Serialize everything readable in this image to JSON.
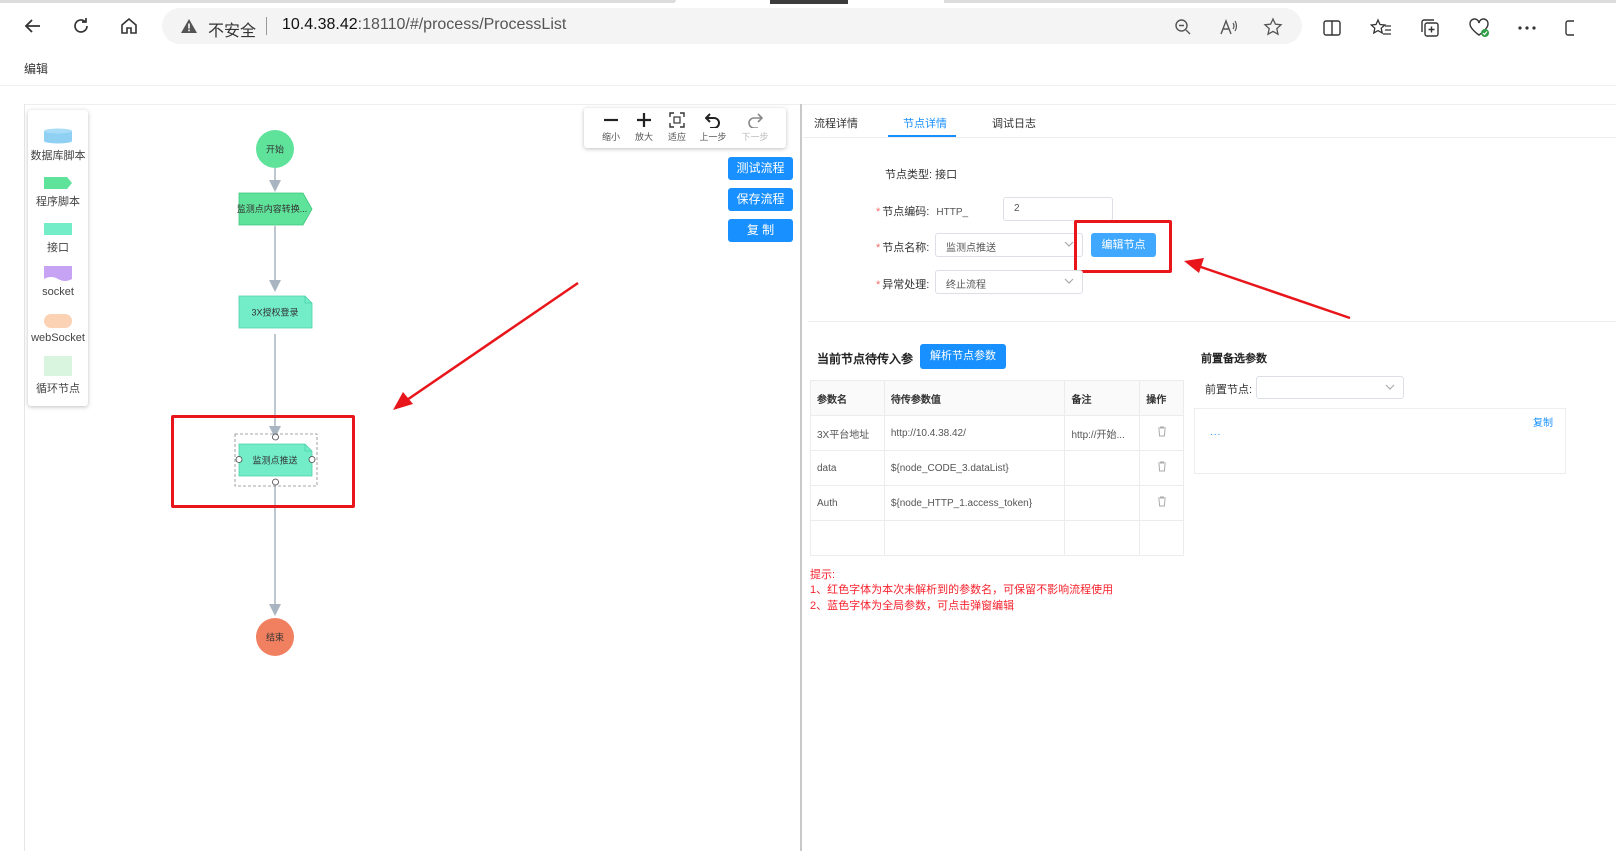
{
  "browser": {
    "insecure_label": "不安全",
    "url_host": "10.4.38.42",
    "url_rest": ":18110/#/process/ProcessList"
  },
  "page": {
    "title": "编辑"
  },
  "palette": {
    "items": [
      {
        "label": "数据库脚本",
        "icon": "database-icon"
      },
      {
        "label": "程序脚本",
        "icon": "script-icon"
      },
      {
        "label": "接口",
        "icon": "interface-icon"
      },
      {
        "label": "socket",
        "icon": "socket-icon"
      },
      {
        "label": "webSocket",
        "icon": "websocket-icon"
      },
      {
        "label": "循环节点",
        "icon": "loop-icon"
      }
    ]
  },
  "flow": {
    "nodes": {
      "start": "开始",
      "monitor": "监测点内容转换...",
      "login": "3X授权登录",
      "push": "监测点推送",
      "end": "结束"
    }
  },
  "zoombar": {
    "zoom_out": "缩小",
    "zoom_in": "放大",
    "fit": "适应",
    "undo": "上一步",
    "redo": "下一步"
  },
  "actions": {
    "test": "测试流程",
    "save": "保存流程",
    "copy": "复 制"
  },
  "tabs": [
    "流程详情",
    "节点详情",
    "调试日志"
  ],
  "active_tab": "节点详情",
  "node_form": {
    "type_label": "节点类型:",
    "type_value": "接口",
    "code_label": "节点编码:",
    "code_prefix": "HTTP_",
    "code_value": "2",
    "name_label": "节点名称:",
    "name_value": "监测点推送",
    "edit_button": "编辑节点",
    "error_label": "异常处理:",
    "error_value": "终止流程"
  },
  "params": {
    "title": "当前节点待传入参",
    "parse_button": "解析节点参数",
    "columns": [
      "参数名",
      "待传参数值",
      "备注",
      "操作"
    ],
    "rows": [
      {
        "name": "3X平台地址",
        "value": "http://10.4.38.42/",
        "note": "http://开始..."
      },
      {
        "name": "data",
        "value": "${node_CODE_3.dataList}",
        "note": ""
      },
      {
        "name": "Auth",
        "value": "${node_HTTP_1.access_token}",
        "note": ""
      }
    ]
  },
  "hints": [
    "提示:",
    "1、红色字体为本次未解析到的参数名，可保留不影响流程使用",
    "2、蓝色字体为全局参数，可点击弹窗编辑"
  ],
  "prev_params": {
    "title": "前置备选参数",
    "node_label": "前置节点:",
    "node_value": "",
    "copy_link": "复制",
    "content": "..."
  },
  "colors": {
    "primary": "#1890ff",
    "start_node": "#5fe39a",
    "end_node": "#f08060",
    "highlight_red": "#e8161b"
  }
}
